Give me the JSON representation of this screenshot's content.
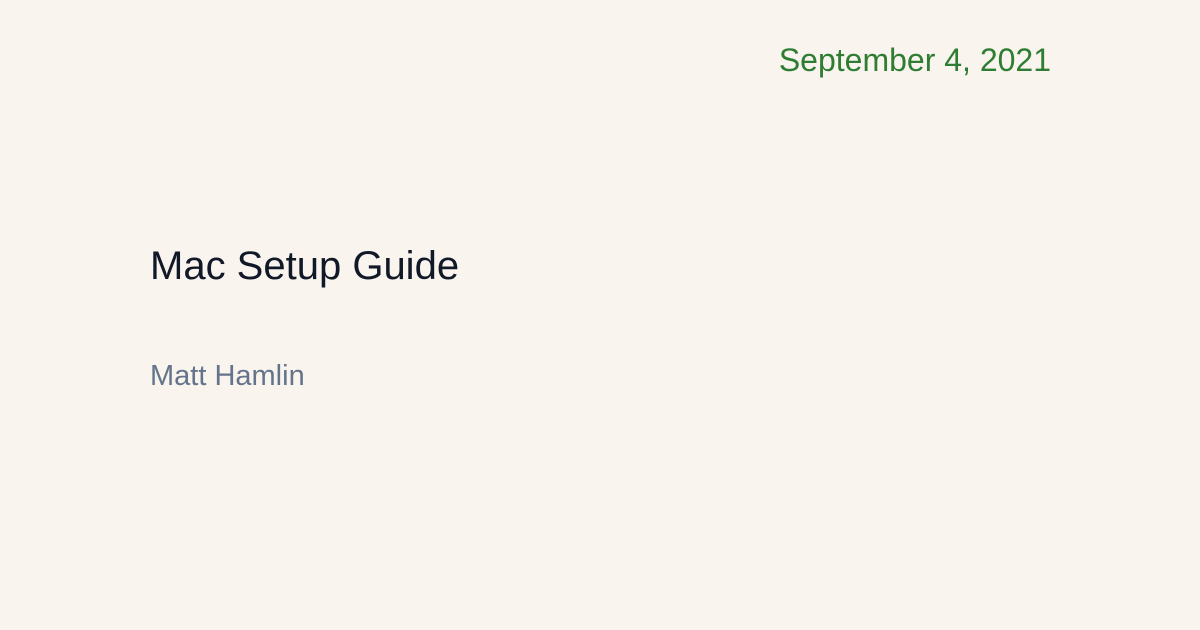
{
  "card": {
    "date": "September 4, 2021",
    "title": "Mac Setup Guide",
    "author": "Matt Hamlin"
  },
  "colors": {
    "background": "#f9f4ee",
    "date": "#2e7d32",
    "title": "#111827",
    "author": "#64748b"
  }
}
